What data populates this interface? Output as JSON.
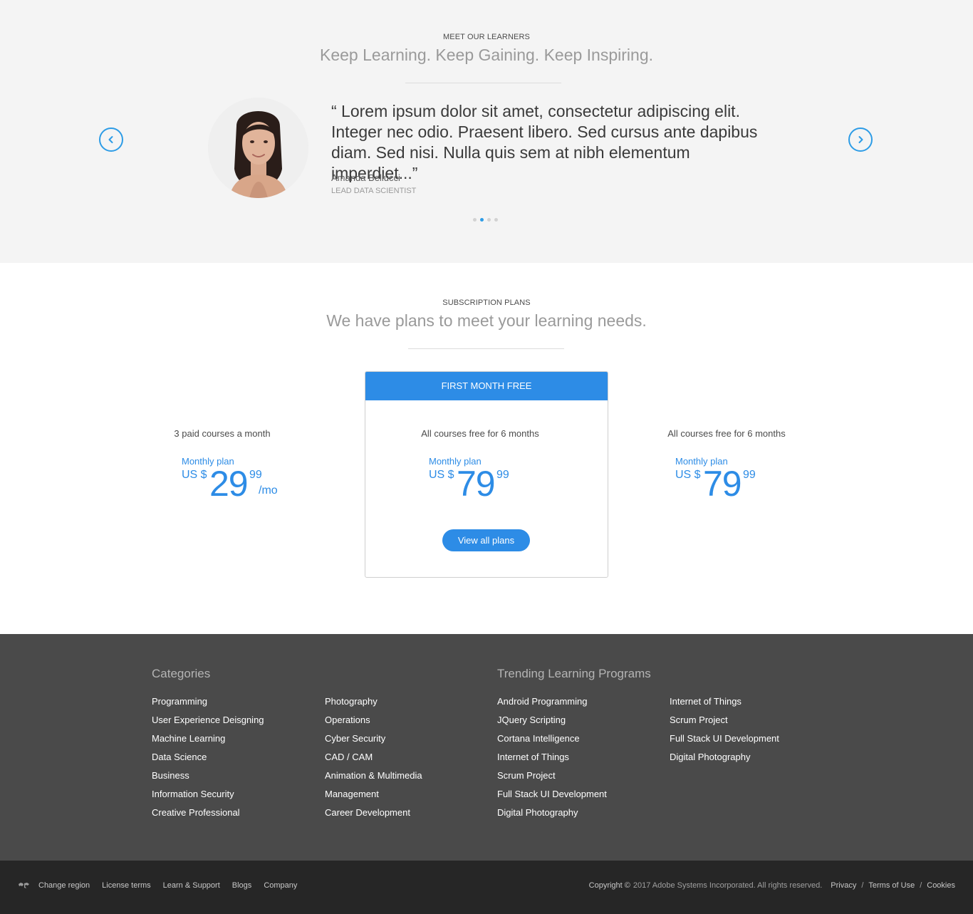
{
  "learners": {
    "eyebrow": "MEET OUR LEARNERS",
    "headline": "Keep Learning. Keep Gaining. Keep Inspiring.",
    "quote": "“ Lorem ipsum dolor sit amet, consectetur adipiscing elit. Integer nec odio. Praesent libero. Sed cursus ante dapibus diam. Sed nisi. Nulla quis sem at nibh elementum imperdiet...”",
    "name": "Amanda Bellucci",
    "role": "LEAD DATA SCIENTIST",
    "slide_count": 4,
    "active_slide": 2,
    "prev_icon": "chevron-left-icon",
    "next_icon": "chevron-right-icon"
  },
  "plans": {
    "eyebrow": "SUBSCRIPTION PLANS",
    "headline": "We have plans to meet your learning needs.",
    "featured_banner": "FIRST MONTH FREE",
    "items": [
      {
        "title": "3 paid courses a month",
        "monthly_label": "Monthly plan",
        "currency": "US $",
        "amount": "29",
        "cents": "99",
        "period": "/mo"
      },
      {
        "title": "All courses free for 6 months",
        "monthly_label": "Monthly plan",
        "currency": "US $",
        "amount": "79",
        "cents": "99",
        "period": ""
      },
      {
        "title": "All courses free for 6 months",
        "monthly_label": "Monthly plan",
        "currency": "US $",
        "amount": "79",
        "cents": "99",
        "period": ""
      }
    ],
    "view_all_label": "View all plans"
  },
  "footer": {
    "categories_heading": "Categories",
    "categories_col1": [
      "Programming",
      "User Experience Deisgning",
      "Machine Learning",
      "Data Science",
      "Business",
      "Information Security",
      "Creative Professional"
    ],
    "categories_col2": [
      "Photography",
      "Operations",
      "Cyber Security",
      "CAD / CAM",
      "Animation & Multimedia",
      "Management",
      "Career Development"
    ],
    "trending_heading": "Trending Learning Programs",
    "trending_col1": [
      "Android Programming",
      "JQuery Scripting",
      "Cortana Intelligence",
      "Internet of Things",
      "Scrum Project",
      "Full Stack UI Development",
      "Digital Photography"
    ],
    "trending_col2": [
      "Internet of Things",
      "Scrum Project",
      "Full Stack UI Development",
      "Digital Photography"
    ]
  },
  "bottombar": {
    "region_icon": "globe-map-icon",
    "change_region": "Change region",
    "links": [
      "License terms",
      "Learn & Support",
      "Blogs",
      "Company"
    ],
    "copyright_strong": "Copyright ©",
    "copyright_text": "2017 Adobe Systems Incorporated. All rights reserved.",
    "legal": [
      "Privacy",
      "Terms of Use",
      "Cookies"
    ]
  },
  "colors": {
    "accent": "#2d8ce6",
    "footer_bg": "#4a4a4a",
    "bottombar_bg": "#262626",
    "learners_bg": "#f4f4f4"
  }
}
